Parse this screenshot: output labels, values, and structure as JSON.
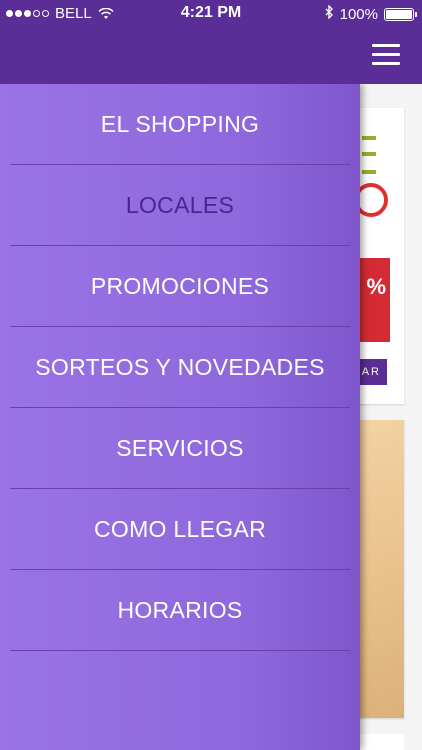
{
  "status_bar": {
    "carrier": "BELL",
    "time": "4:21 PM",
    "battery": "100%",
    "signal_filled": 3,
    "signal_total": 5
  },
  "colors": {
    "header": "#5a2d97",
    "drawer": "#9a73e6",
    "active_item": "#4b2590"
  },
  "header": {
    "menu_icon": "hamburger-icon"
  },
  "menu": {
    "items": [
      {
        "label": "EL SHOPPING"
      },
      {
        "label": "LOCALES",
        "active": true
      },
      {
        "label": "PROMOCIONES"
      },
      {
        "label": "SORTEOS Y NOVEDADES"
      },
      {
        "label": "SERVICIOS"
      },
      {
        "label": "COMO LLEGAR"
      },
      {
        "label": "HORARIOS"
      }
    ]
  },
  "background": {
    "promo_percent": "%",
    "button_label": "AR"
  }
}
